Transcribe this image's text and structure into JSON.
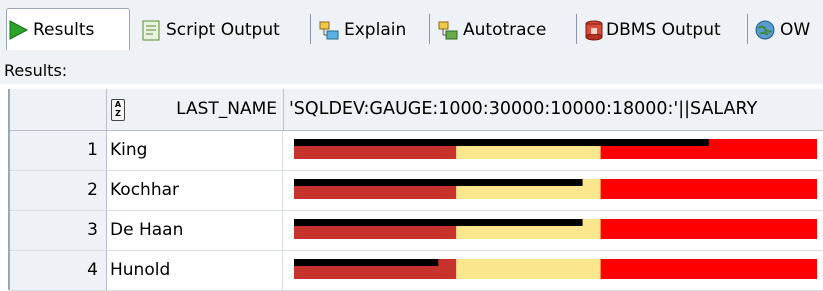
{
  "tabs": [
    {
      "label": "Results",
      "icon": "play-icon"
    },
    {
      "label": "Script Output",
      "icon": "script-icon"
    },
    {
      "label": "Explain",
      "icon": "explain-icon"
    },
    {
      "label": "Autotrace",
      "icon": "autotrace-icon"
    },
    {
      "label": "DBMS Output",
      "icon": "dbms-icon"
    },
    {
      "label": "OW",
      "icon": "owa-icon"
    }
  ],
  "results_label": "Results:",
  "grid": {
    "columns": [
      {
        "label": ""
      },
      {
        "label": "LAST_NAME"
      },
      {
        "label": "'SQLDEV:GAUGE:1000:30000:10000:18000:'||SALARY"
      }
    ],
    "gauge_range": {
      "min": 1000,
      "max": 30000,
      "low": 10000,
      "high": 18000
    },
    "rows": [
      {
        "num": "1",
        "last_name": "King",
        "salary": 24000
      },
      {
        "num": "2",
        "last_name": "Kochhar",
        "salary": 17000
      },
      {
        "num": "3",
        "last_name": "De Haan",
        "salary": 17000
      },
      {
        "num": "4",
        "last_name": "Hunold",
        "salary": 9000
      }
    ]
  },
  "colors": {
    "low": "#c8322d",
    "mid": "#fae68c",
    "high": "#ff0000",
    "value_bar": "#000000"
  }
}
